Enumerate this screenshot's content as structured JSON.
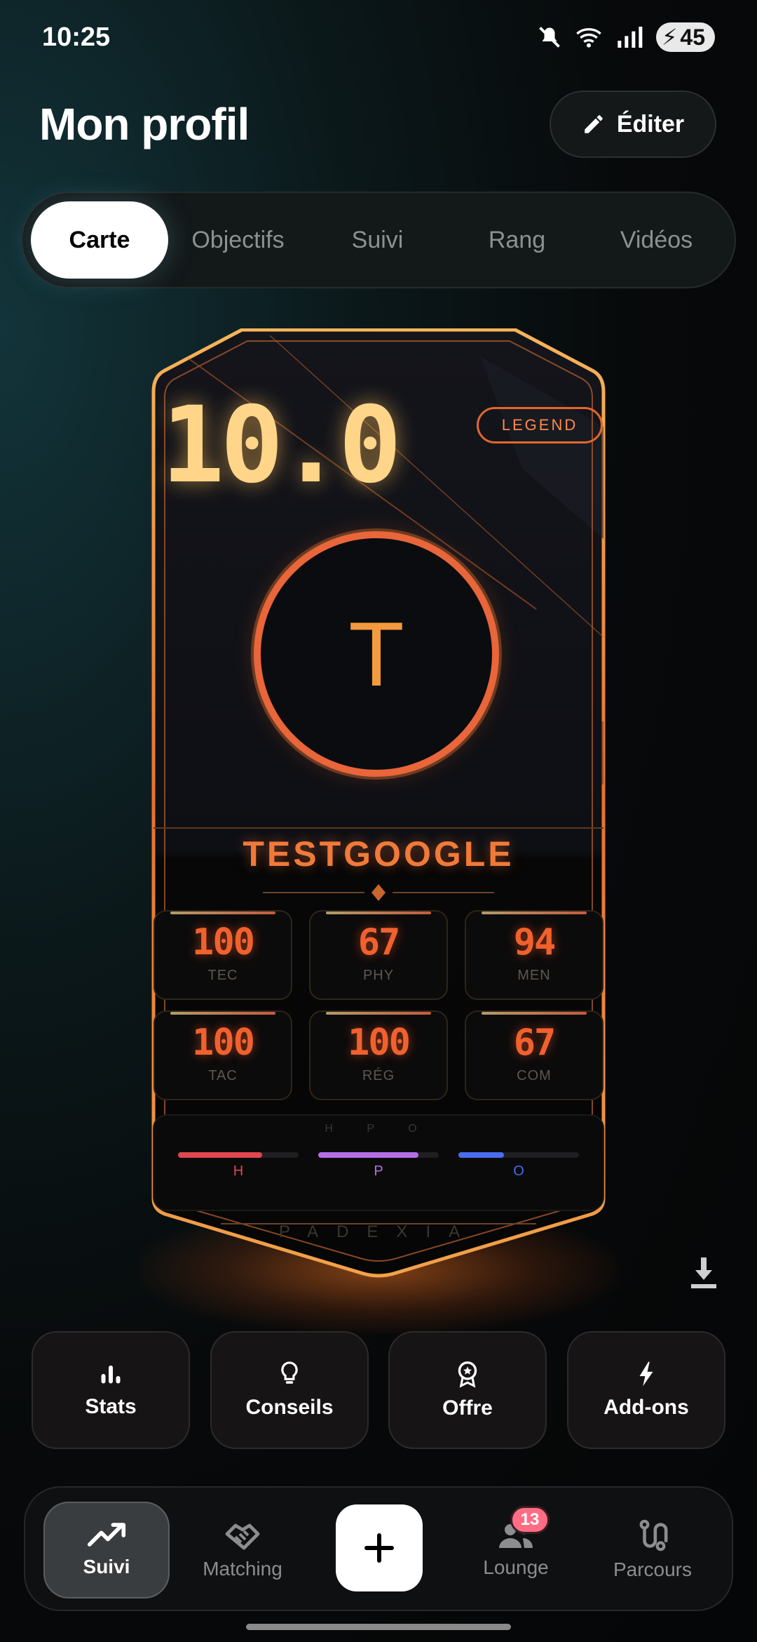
{
  "status_bar": {
    "time": "10:25",
    "battery": "45"
  },
  "header": {
    "title": "Mon profil",
    "edit_label": "Éditer"
  },
  "tabs": [
    {
      "label": "Carte",
      "active": true
    },
    {
      "label": "Objectifs"
    },
    {
      "label": "Suivi"
    },
    {
      "label": "Rang"
    },
    {
      "label": "Vidéos"
    }
  ],
  "card": {
    "rating": "10.0",
    "tier": "LEGEND",
    "avatar_initial": "T",
    "player_name": "TESTGOOGLE",
    "stats": [
      {
        "value": "100",
        "label": "TEC"
      },
      {
        "value": "67",
        "label": "PHY"
      },
      {
        "value": "94",
        "label": "MEN"
      },
      {
        "value": "100",
        "label": "TAC"
      },
      {
        "value": "100",
        "label": "RÉG"
      },
      {
        "value": "67",
        "label": "COM"
      }
    ],
    "hpo": {
      "title": "H P O",
      "meters": [
        {
          "label": "H",
          "fraction": 0.7,
          "color": "#e0474f"
        },
        {
          "label": "P",
          "fraction": 0.83,
          "color": "#b56ee8"
        },
        {
          "label": "O",
          "fraction": 0.38,
          "color": "#4a6cf0"
        }
      ]
    },
    "brand": "PADEXIA"
  },
  "actions": [
    {
      "label": "Stats",
      "icon": "bar-chart-icon"
    },
    {
      "label": "Conseils",
      "icon": "lightbulb-icon"
    },
    {
      "label": "Offre",
      "icon": "award-icon"
    },
    {
      "label": "Add-ons",
      "icon": "lightning-icon"
    }
  ],
  "bottom_nav": {
    "items": [
      {
        "label": "Suivi",
        "icon": "trending-up-icon",
        "active": true
      },
      {
        "label": "Matching",
        "icon": "handshake-icon"
      },
      {
        "label": "Lounge",
        "icon": "users-icon",
        "badge": "13"
      },
      {
        "label": "Parcours",
        "icon": "route-icon"
      }
    ]
  },
  "colors": {
    "accent": "#f1612d",
    "gold": "#ffd58a"
  }
}
